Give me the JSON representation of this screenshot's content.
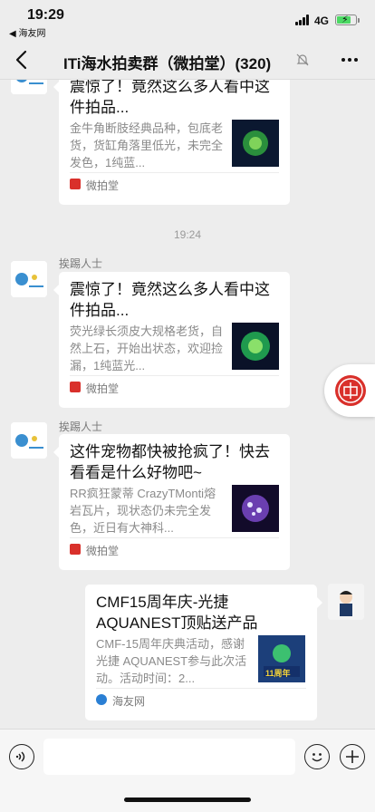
{
  "status": {
    "time": "19:29",
    "back_app": "◀ 海友网",
    "network": "4G"
  },
  "nav": {
    "title": "ITi海水拍卖群（微拍堂）(320)"
  },
  "messages": [
    {
      "sender": "",
      "title": "震惊了！竟然这么多人看中这件拍品...",
      "desc": "金牛角断肢经典品种，包底老货，货缸角落里低光，未完全发色，1纯蓝...",
      "source": "微拍堂"
    },
    {
      "sender": "挨踢人士",
      "title": "震惊了！竟然这么多人看中这件拍品...",
      "desc": "荧光绿长须皮大规格老货，自然上石，开始出状态，欢迎捡漏，1纯蓝光...",
      "source": "微拍堂"
    },
    {
      "sender": "挨踢人士",
      "title": "这件宠物都快被抢疯了！快去看看是什么好物吧~",
      "desc": "RR疯狂蒙蒂 CrazyTMonti熔岩瓦片，现状态仍未完全发色，近日有大神科...",
      "source": "微拍堂"
    },
    {
      "sender": "",
      "title": "CMF15周年庆-光捷AQUANEST顶贴送产品",
      "desc": "CMF-15周年庆典活动，感谢光捷 AQUANEST参与此次活动。活动时间：2...",
      "source": "海友网",
      "thumb_text": "11周年"
    }
  ],
  "time_separator": "19:24",
  "colors": {
    "background": "#ededed",
    "card": "#ffffff",
    "source_icon_weipaitang": "#d9302b",
    "source_icon_haiyou": "#2a7fd4",
    "battery": "#4cd964"
  },
  "icons": [
    "back-icon",
    "mute-icon",
    "more-icon",
    "voice-icon",
    "emoji-icon",
    "plus-icon",
    "auction-float-icon"
  ]
}
